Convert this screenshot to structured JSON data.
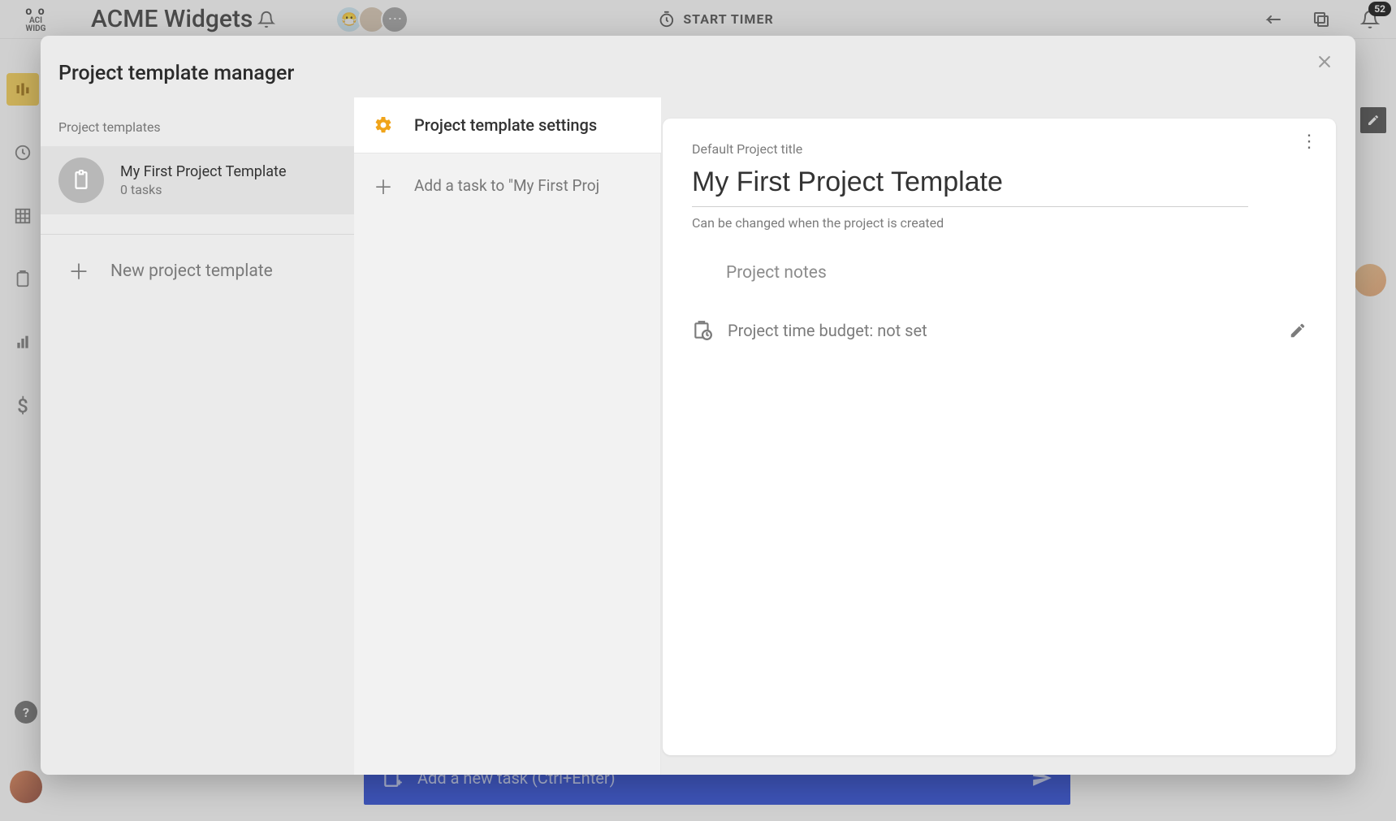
{
  "bg": {
    "logo_top": "o o",
    "logo_line1": "ACI",
    "logo_line2": "WIDG",
    "workspace_title": "ACME Widgets",
    "timer_label": "START TIMER",
    "notif_count": "52",
    "task_bar_text": "Add a new task (Ctrl+Enter)"
  },
  "modal": {
    "title": "Project template manager",
    "section_label": "Project templates",
    "template": {
      "name": "My First Project Template",
      "subtitle": "0 tasks"
    },
    "new_template_label": "New project template",
    "settings_label": "Project template settings",
    "add_task_label": "Add a task to \"My First Proj"
  },
  "card": {
    "field_label": "Default Project title",
    "title_value": "My First Project Template",
    "hint": "Can be changed when the project is created",
    "notes_placeholder": "Project notes",
    "budget_label": "Project time budget: not set"
  }
}
